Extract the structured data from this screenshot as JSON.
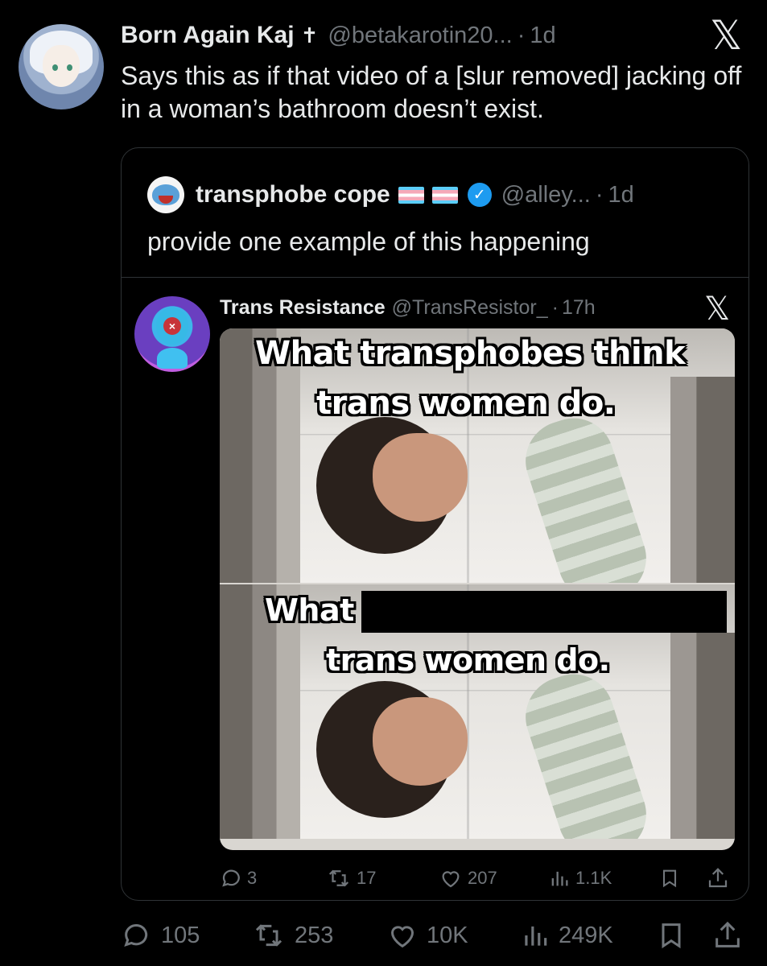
{
  "post": {
    "display_name": "Born Again Kaj",
    "name_emoji": "✝",
    "handle": "@betakarotin20...",
    "separator": "·",
    "time": "1d",
    "body": "Says this as if that video of a [slur removed] jacking off in a woman’s bathroom doesn’t exist.",
    "actions": {
      "replies": "105",
      "reposts": "253",
      "likes": "10K",
      "views": "249K"
    }
  },
  "quoted_post": {
    "display_name": "transphobe cope",
    "handle": "@alley...",
    "separator": "·",
    "time": "1d",
    "verified": true,
    "body": "provide one example of this happening",
    "nested_quote": {
      "display_name": "Trans Resistance",
      "handle": "@TransResistor_",
      "separator": "·",
      "time": "17h",
      "image": {
        "top_caption_line1": "What transphobes think",
        "top_caption_line2": "trans women do.",
        "bottom_caption_line1": "What",
        "bottom_caption_line2": "trans women do."
      },
      "actions": {
        "replies": "3",
        "reposts": "17",
        "likes": "207",
        "views": "1.1K"
      }
    }
  },
  "colors": {
    "background": "#000000",
    "text_primary": "#e7e9ea",
    "text_secondary": "#71767b",
    "border": "#2f3336",
    "verified_blue": "#1d9bf0"
  },
  "icons": [
    "x-logo-icon",
    "verified-badge-icon",
    "reply-icon",
    "repost-icon",
    "like-icon",
    "views-icon",
    "bookmark-icon",
    "share-icon"
  ]
}
